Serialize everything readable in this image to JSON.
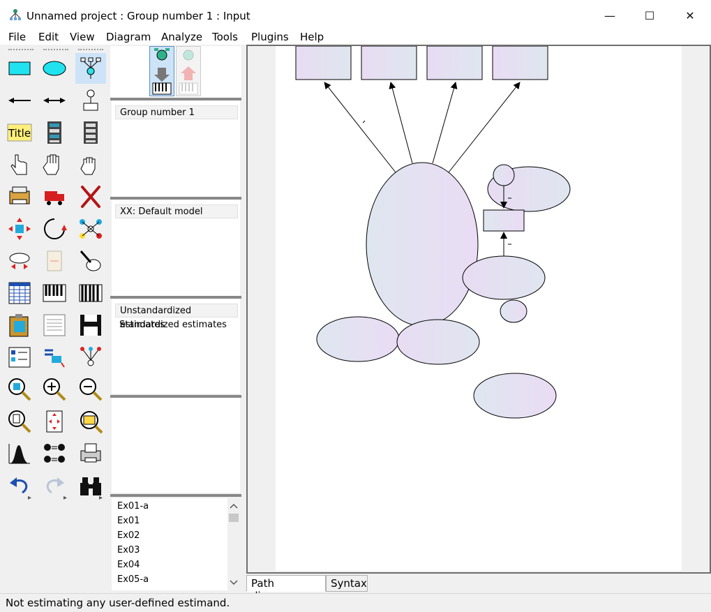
{
  "window": {
    "title": "Unnamed project : Group number 1 : Input",
    "minimize": "—",
    "maximize": "☐",
    "close": "✕"
  },
  "menu": [
    "File",
    "Edit",
    "View",
    "Diagram",
    "Analyze",
    "Tools",
    "Plugins",
    "Help"
  ],
  "toolbox": {
    "title_tool_label": "Title",
    "more_arrow": "▸"
  },
  "panels": {
    "groups": [
      "Group number 1"
    ],
    "models": [
      "XX: Default model"
    ],
    "estimates": [
      "Unstandardized estimates",
      "Standardized estimates"
    ],
    "files": [
      "Ex01-a",
      "Ex01",
      "Ex02",
      "Ex03",
      "Ex04",
      "Ex05-a"
    ]
  },
  "tabs": [
    "Path diagram",
    "Syntax"
  ],
  "status": "Not estimating any user-defined estimand.",
  "colors": {
    "shape_fill_a": "#e8dcf2",
    "shape_fill_b": "#dfe6f0",
    "selection": "#cde3f7"
  }
}
